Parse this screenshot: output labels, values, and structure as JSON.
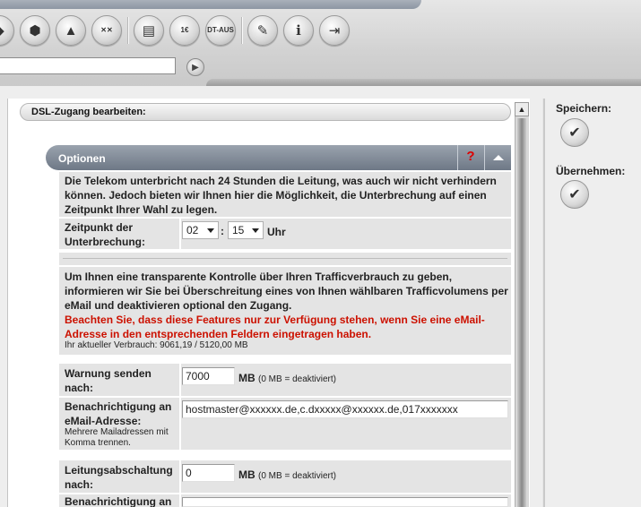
{
  "toolbar": {
    "icons": [
      {
        "name": "box-icon",
        "glyph": "◆"
      },
      {
        "name": "network-icon",
        "glyph": "⬢"
      },
      {
        "name": "pyramid-icon",
        "glyph": "▲"
      },
      {
        "name": "xx-icon",
        "glyph": "✕✕"
      },
      {
        "name": "document-icon",
        "glyph": "▤"
      },
      {
        "name": "euro-document-icon",
        "glyph": "1€"
      },
      {
        "name": "dt-aus-icon",
        "glyph": "DT-AUS"
      },
      {
        "name": "tools-icon",
        "glyph": "✎"
      },
      {
        "name": "info-icon",
        "glyph": "i"
      },
      {
        "name": "exit-icon",
        "glyph": "⇥"
      }
    ],
    "go_glyph": "▶"
  },
  "section": {
    "title": "DSL-Zugang bearbeiten:"
  },
  "options": {
    "title": "Optionen",
    "help": "?",
    "intro": "Die Telekom unterbricht nach 24 Stunden die Leitung, was auch wir nicht verhindern können. Jedoch bieten wir Ihnen hier die Möglichkeit, die Unterbrechung auf einen Zeitpunkt Ihrer Wahl zu legen.",
    "interrupt_label": "Zeitpunkt der Unterbrechung:",
    "hour": "02",
    "minute": "15",
    "colon": ":",
    "unit_uhr": "Uhr",
    "traffic_intro": "Um Ihnen eine transparente Kontrolle über Ihren Trafficverbrauch zu geben, informieren wir Sie bei Überschreitung eines von Ihnen wählbaren Trafficvolumens per eMail und deaktivieren optional den Zugang.",
    "traffic_warning": "Beachten Sie, dass diese Features nur zur Verfügung stehen, wenn Sie eine eMail-Adresse in den entsprechenden Feldern eingetragen haben.",
    "usage": "Ihr aktueller Verbrauch: 9061,19 / 5120,00 MB",
    "warn_label": "Warnung senden nach:",
    "warn_value": "7000",
    "mb": "MB",
    "deactivated_hint": "(0 MB = deaktiviert)",
    "notify_label": "Benachrichtigung an eMail-Adresse:",
    "notify_hint": "Mehrere Mailadressen mit Komma trennen.",
    "notify_value": "hostmaster@xxxxxx.de,c.dxxxxx@xxxxxx.de,017xxxxxxx",
    "shutdown_label": "Leitungsabschaltung nach:",
    "shutdown_value": "0",
    "notify2_label": "Benachrichtigung an"
  },
  "side": {
    "save_label": "Speichern:",
    "apply_label": "Übernehmen:",
    "check_glyph": "✔"
  }
}
